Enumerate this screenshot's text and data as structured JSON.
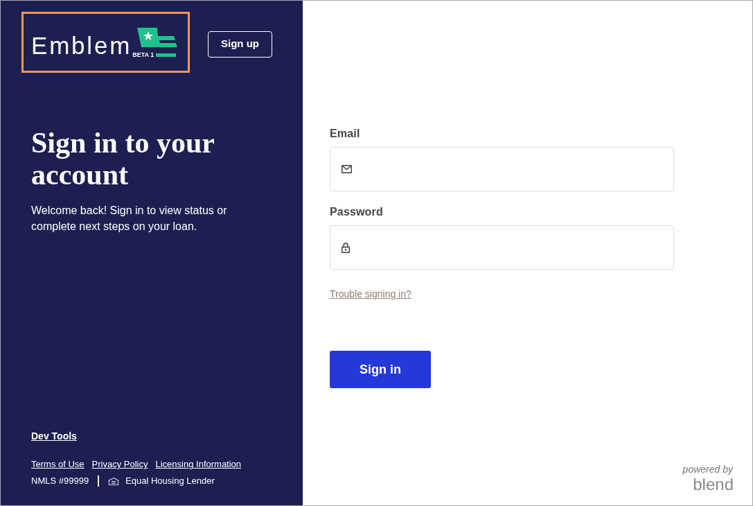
{
  "logo": {
    "wordmark": "Emblem",
    "badge": "BETA 1",
    "highlighted": true
  },
  "header": {
    "signup_button": "Sign up"
  },
  "intro": {
    "title": "Sign in to your account",
    "text": "Welcome back! Sign in to view status or complete next steps on your loan."
  },
  "footer": {
    "dev_tools": "Dev Tools",
    "links": [
      "Terms of Use",
      "Privacy Policy",
      "Licensing Information"
    ],
    "nmls": "NMLS #99999",
    "equal_housing": "Equal Housing Lender"
  },
  "form": {
    "fields": [
      {
        "label": "Email",
        "kind": "email"
      },
      {
        "label": "Password",
        "kind": "password"
      }
    ],
    "help_link": "Trouble signing in?",
    "submit": "Sign in"
  },
  "branding": {
    "powered_by": "powered by",
    "brand": "blend"
  }
}
